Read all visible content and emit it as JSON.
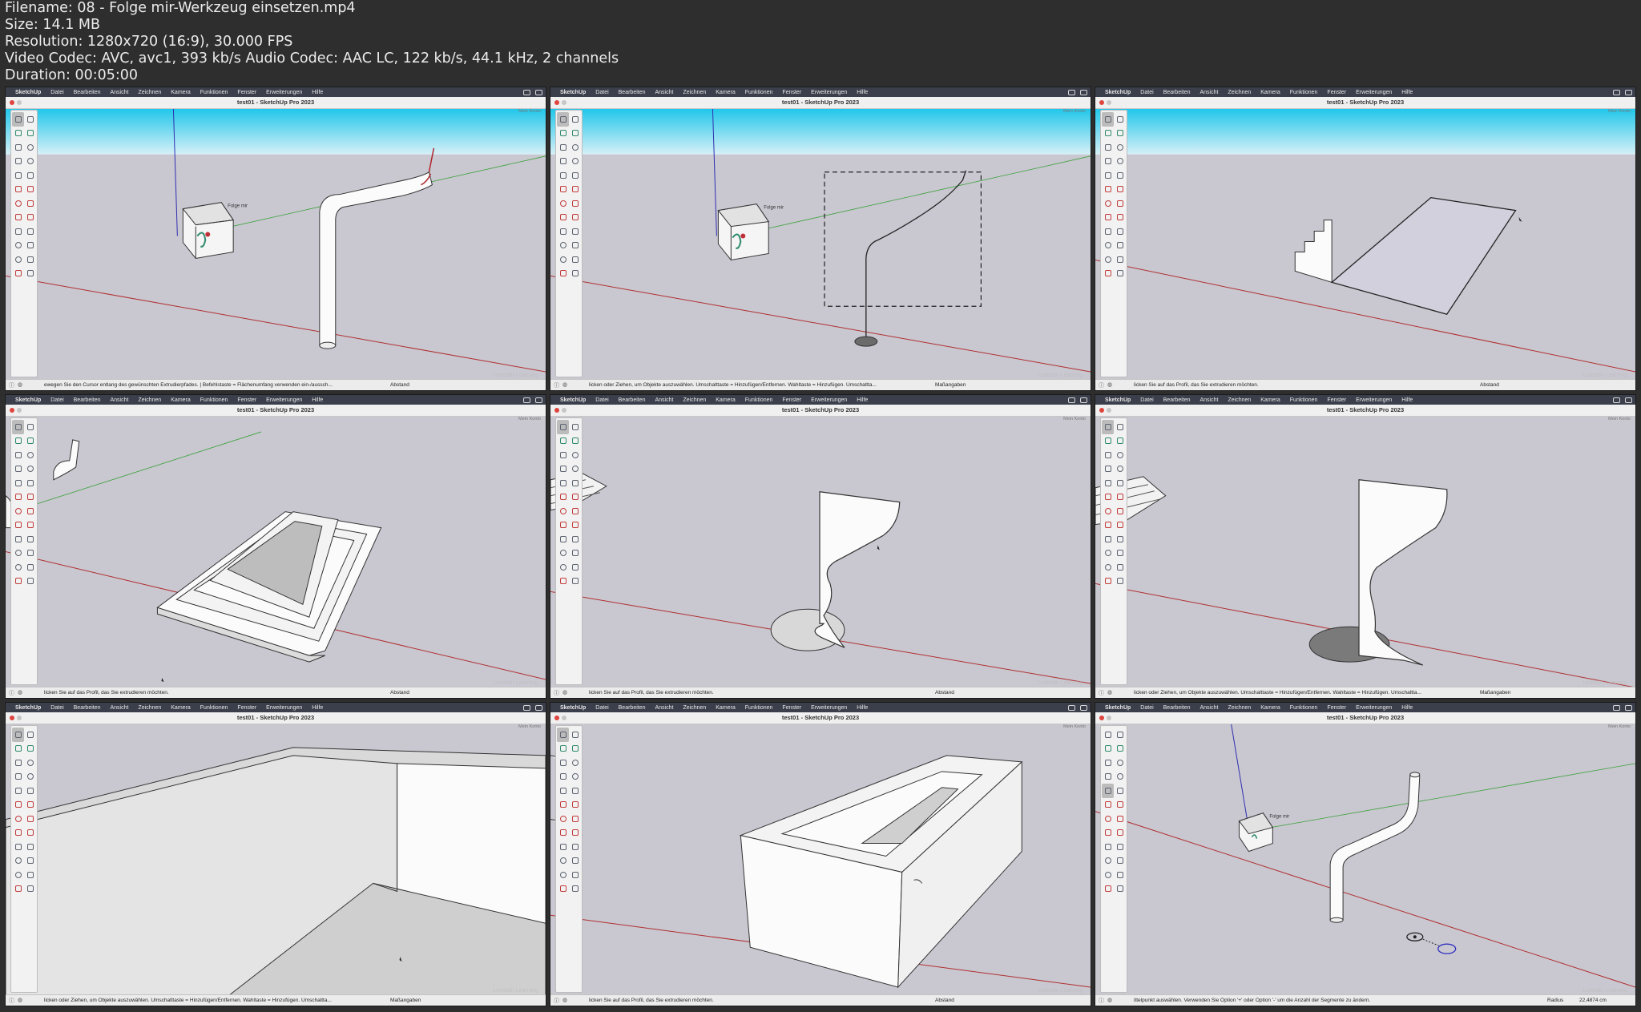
{
  "file_info": {
    "filename": "Filename: 08 - Folge mir-Werkzeug einsetzen.mp4",
    "size": "Size: 14.1 MB",
    "resolution": "Resolution: 1280x720 (16:9), 30.000 FPS",
    "codec": "Video Codec: AVC, avc1, 393 kb/s Audio Codec: AAC LC, 122 kb/s, 44.1 kHz, 2 channels",
    "duration": "Duration: 00:05:00"
  },
  "app": {
    "menu": [
      "SketchUp",
      "Datei",
      "Bearbeiten",
      "Ansicht",
      "Zeichnen",
      "Kamera",
      "Funktionen",
      "Fenster",
      "Erweiterungen",
      "Hilfe"
    ],
    "window_title": "test01 - SketchUp Pro 2023",
    "account": "Mein Konto",
    "label_folge_mir": "Folge mir",
    "watermark": "LinkedIn Learning"
  },
  "frames": [
    {
      "hint": "ewegen Sie den Cursor entlang des gewünschten Extrudierpfades. | Befehlstaste = Flächenumfang verwenden ein-/aussch...",
      "vcb_label": "Abstand",
      "vcb_value": ""
    },
    {
      "hint": "licken oder Ziehen, um Objekte auszuwählen. Umschalttaste = Hinzufügen/Entfernen. Wahltaste = Hinzufügen. Umschaltta...",
      "vcb_label": "Maßangaben",
      "vcb_value": ""
    },
    {
      "hint": "licken Sie auf das Profil, das Sie extrudieren möchten.",
      "vcb_label": "Abstand",
      "vcb_value": ""
    },
    {
      "hint": "licken Sie auf das Profil, das Sie extrudieren möchten.",
      "vcb_label": "Abstand",
      "vcb_value": ""
    },
    {
      "hint": "licken Sie auf das Profil, das Sie extrudieren möchten.",
      "vcb_label": "Abstand",
      "vcb_value": ""
    },
    {
      "hint": "licken oder Ziehen, um Objekte auszuwählen. Umschalttaste = Hinzufügen/Entfernen. Wahltaste = Hinzufügen. Umschaltta...",
      "vcb_label": "Maßangaben",
      "vcb_value": ""
    },
    {
      "hint": "licken oder Ziehen, um Objekte auszuwählen. Umschalttaste = Hinzufügen/Entfernen. Wahltaste = Hinzufügen. Umschaltta...",
      "vcb_label": "Maßangaben",
      "vcb_value": ""
    },
    {
      "hint": "licken Sie auf das Profil, das Sie extrudieren möchten.",
      "vcb_label": "Abstand",
      "vcb_value": ""
    },
    {
      "hint": "ittelpunkt auswählen. Verwenden Sie Option '+' oder Option '-' um die Anzahl der Segmente zu ändern.",
      "vcb_label": "Radius",
      "vcb_value": "22,4874 cm"
    }
  ]
}
